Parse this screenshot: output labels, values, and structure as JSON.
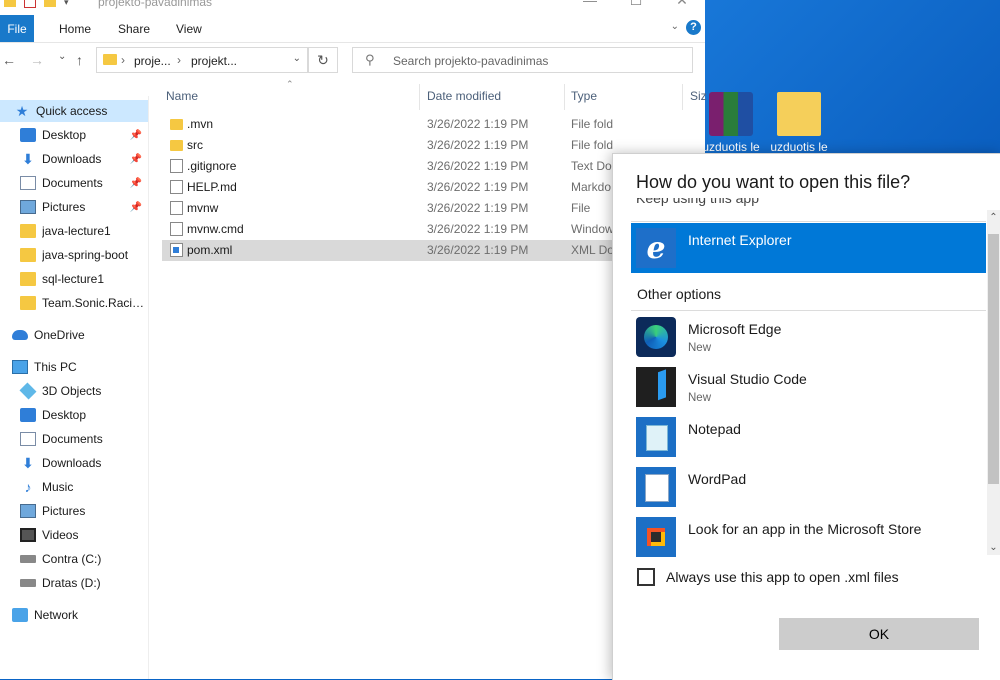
{
  "window": {
    "title": "projekto-pavadinimas",
    "controls": [
      "—",
      "☐",
      "✕"
    ]
  },
  "ribbon": {
    "file": "File",
    "tabs": [
      "Home",
      "Share",
      "View"
    ],
    "help": "?"
  },
  "nav": {
    "back": "←",
    "forward": "→",
    "recent": "⌄",
    "up": "↑",
    "breadcrumb": [
      "proje...",
      "projekt..."
    ],
    "refresh": "↻",
    "search_placeholder": "Search projekto-pavadinimas"
  },
  "sidebar": {
    "items": [
      {
        "label": "Quick access",
        "icon": "star-icon",
        "pinned": false
      },
      {
        "label": "Desktop",
        "icon": "desktop-icon",
        "pinned": true
      },
      {
        "label": "Downloads",
        "icon": "download-icon",
        "pinned": true
      },
      {
        "label": "Documents",
        "icon": "documents-icon",
        "pinned": true
      },
      {
        "label": "Pictures",
        "icon": "pictures-icon",
        "pinned": true
      },
      {
        "label": "java-lecture1",
        "icon": "folder-icon",
        "pinned": false
      },
      {
        "label": "java-spring-boot",
        "icon": "folder-icon",
        "pinned": false
      },
      {
        "label": "sql-lecture1",
        "icon": "folder-icon",
        "pinned": false
      },
      {
        "label": "Team.Sonic.Racing-",
        "icon": "folder-icon",
        "pinned": false
      },
      {
        "label": "OneDrive",
        "icon": "onedrive-icon",
        "pinned": false
      },
      {
        "label": "This PC",
        "icon": "this-pc-icon",
        "pinned": false
      },
      {
        "label": "3D Objects",
        "icon": "3d-objects-icon",
        "pinned": false
      },
      {
        "label": "Desktop",
        "icon": "desktop-icon",
        "pinned": false
      },
      {
        "label": "Documents",
        "icon": "documents-icon",
        "pinned": false
      },
      {
        "label": "Downloads",
        "icon": "download-icon",
        "pinned": false
      },
      {
        "label": "Music",
        "icon": "music-icon",
        "pinned": false
      },
      {
        "label": "Pictures",
        "icon": "pictures-icon",
        "pinned": false
      },
      {
        "label": "Videos",
        "icon": "videos-icon",
        "pinned": false
      },
      {
        "label": "Contra (C:)",
        "icon": "drive-icon",
        "pinned": false
      },
      {
        "label": "Dratas (D:)",
        "icon": "drive-icon",
        "pinned": false
      },
      {
        "label": "Network",
        "icon": "network-icon",
        "pinned": false
      }
    ]
  },
  "files": {
    "columns": {
      "name": "Name",
      "date": "Date modified",
      "type": "Type",
      "size": "Siz"
    },
    "rows": [
      {
        "name": ".mvn",
        "date": "3/26/2022 1:19 PM",
        "type": "File folder",
        "icon": "folder-icon"
      },
      {
        "name": "src",
        "date": "3/26/2022 1:19 PM",
        "type": "File folder",
        "icon": "folder-icon"
      },
      {
        "name": ".gitignore",
        "date": "3/26/2022 1:19 PM",
        "type": "Text Do",
        "icon": "file-icon"
      },
      {
        "name": "HELP.md",
        "date": "3/26/2022 1:19 PM",
        "type": "Markdo",
        "icon": "file-icon"
      },
      {
        "name": "mvnw",
        "date": "3/26/2022 1:19 PM",
        "type": "File",
        "icon": "file-icon"
      },
      {
        "name": "mvnw.cmd",
        "date": "3/26/2022 1:19 PM",
        "type": "Window",
        "icon": "file-icon"
      },
      {
        "name": "pom.xml",
        "date": "3/26/2022 1:19 PM",
        "type": "XML Do",
        "icon": "xml-file-icon"
      }
    ]
  },
  "desktop": {
    "icons": [
      {
        "label": "uzduotis le",
        "icon": "winrar-icon"
      },
      {
        "label": "uzduotis le",
        "icon": "folder-icon"
      }
    ]
  },
  "dialog": {
    "title": "How do you want to open this file?",
    "keep_using": "Keep using this app",
    "current_app": {
      "name": "Internet Explorer",
      "icon": "internet-explorer-icon"
    },
    "other_options_label": "Other options",
    "apps": [
      {
        "name": "Microsoft Edge",
        "sub": "New",
        "icon": "microsoft-edge-icon"
      },
      {
        "name": "Visual Studio Code",
        "sub": "New",
        "icon": "vscode-icon"
      },
      {
        "name": "Notepad",
        "sub": "",
        "icon": "notepad-icon"
      },
      {
        "name": "WordPad",
        "sub": "",
        "icon": "wordpad-icon"
      },
      {
        "name": "Look for an app in the Microsoft Store",
        "sub": "",
        "icon": "microsoft-store-icon"
      }
    ],
    "always_use_label": "Always use this app to open .xml files",
    "ok_label": "OK"
  },
  "colors": {
    "accent": "#0078d7",
    "selection_row": "#d9d9d9",
    "sidebar_selected": "#cce8ff",
    "desktop_bg": "#0b5fc0"
  }
}
